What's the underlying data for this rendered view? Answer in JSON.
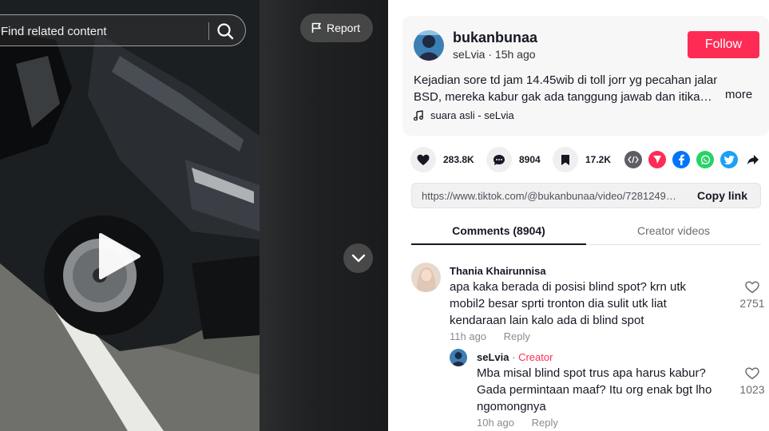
{
  "search": {
    "placeholder": "Find related content"
  },
  "video": {
    "report_label": "Report"
  },
  "post": {
    "username": "bukanbunaa",
    "nickname": "seLvia",
    "time_ago": "15h ago",
    "follow_label": "Follow",
    "description_lines": [
      "Kejadian sore td jam 14.45wib di toll jorr yg pecahan jalan dr",
      "BSD, mereka kabur gak ada tanggung jawab dan itika…"
    ],
    "more_label": "more",
    "music": "suara asli - seLvia"
  },
  "actions": {
    "likes": "283.8K",
    "comments": "8904",
    "saves": "17.2K"
  },
  "share": {
    "link": "https://www.tiktok.com/@bukanbunaa/video/7281249…",
    "copy_label": "Copy link"
  },
  "tabs": {
    "comments": "Comments (8904)",
    "creator_videos": "Creator videos"
  },
  "comments": [
    {
      "name": "Thania Khairunnisa",
      "lines": [
        "apa kaka berada di posisi blind spot? krn utk",
        "mobil2 besar sprti tronton dia sulit utk liat",
        "kendaraan lain kalo ada di blind spot"
      ],
      "time": "11h ago",
      "reply_label": "Reply",
      "likes": "2751"
    },
    {
      "name": "seLvia",
      "separator": "·",
      "badge": "Creator",
      "lines": [
        "Mba misal blind spot trus apa harus kabur?",
        "Gada permintaan maaf? Itu org enak bgt lho",
        "ngomongnya"
      ],
      "time": "10h ago",
      "reply_label": "Reply",
      "likes": "1023"
    }
  ],
  "colors": {
    "brand": "#fe2c55",
    "text": "#161823",
    "muted": "#8a8b91"
  }
}
